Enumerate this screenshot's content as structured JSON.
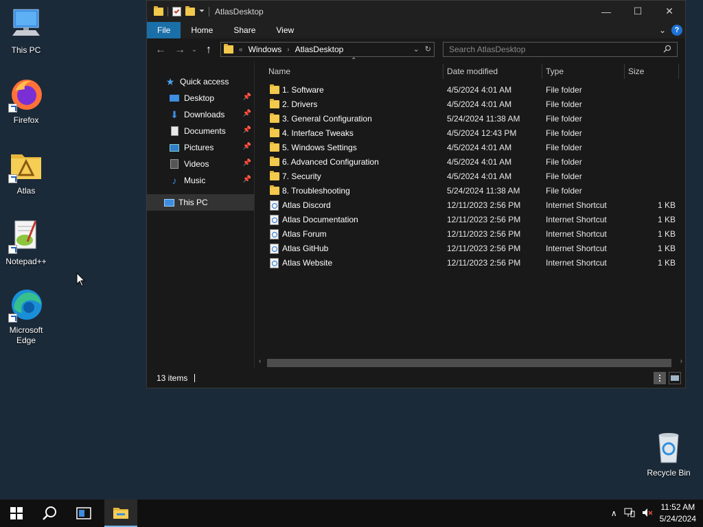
{
  "desktop": {
    "icons": [
      {
        "label": "This PC",
        "icon": "this-pc-icon"
      },
      {
        "label": "Firefox",
        "icon": "firefox-icon"
      },
      {
        "label": "Atlas",
        "icon": "atlas-folder-icon"
      },
      {
        "label": "Notepad++",
        "icon": "notepad-plus-plus-icon"
      },
      {
        "label": "Microsoft Edge",
        "icon": "edge-icon"
      },
      {
        "label": "Recycle Bin",
        "icon": "recycle-bin-icon"
      }
    ]
  },
  "window": {
    "title": "AtlasDesktop",
    "controls": {
      "minimize": "—",
      "maximize": "☐",
      "close": "✕"
    },
    "ribbon": {
      "tabs": [
        "File",
        "Home",
        "Share",
        "View"
      ],
      "help": "?"
    },
    "nav": {
      "back": "←",
      "forward": "→",
      "recent": "⌄",
      "up": "↑"
    },
    "address": {
      "overflow": "«",
      "segments": [
        "Windows",
        "AtlasDesktop"
      ],
      "separator": "›"
    },
    "search": {
      "placeholder": "Search AtlasDesktop"
    },
    "navpane": {
      "quick_access": "Quick access",
      "items": [
        {
          "label": "Desktop",
          "icon": "desktop-icon"
        },
        {
          "label": "Downloads",
          "icon": "downloads-icon"
        },
        {
          "label": "Documents",
          "icon": "documents-icon"
        },
        {
          "label": "Pictures",
          "icon": "pictures-icon"
        },
        {
          "label": "Videos",
          "icon": "videos-icon"
        },
        {
          "label": "Music",
          "icon": "music-icon"
        }
      ],
      "this_pc": "This PC"
    },
    "columns": {
      "name": "Name",
      "date": "Date modified",
      "type": "Type",
      "size": "Size"
    },
    "files": [
      {
        "name": "1. Software",
        "date": "4/5/2024 4:01 AM",
        "type": "File folder",
        "size": "",
        "kind": "folder"
      },
      {
        "name": "2. Drivers",
        "date": "4/5/2024 4:01 AM",
        "type": "File folder",
        "size": "",
        "kind": "folder"
      },
      {
        "name": "3. General Configuration",
        "date": "5/24/2024 11:38 AM",
        "type": "File folder",
        "size": "",
        "kind": "folder"
      },
      {
        "name": "4. Interface Tweaks",
        "date": "4/5/2024 12:43 PM",
        "type": "File folder",
        "size": "",
        "kind": "folder"
      },
      {
        "name": "5. Windows Settings",
        "date": "4/5/2024 4:01 AM",
        "type": "File folder",
        "size": "",
        "kind": "folder"
      },
      {
        "name": "6. Advanced Configuration",
        "date": "4/5/2024 4:01 AM",
        "type": "File folder",
        "size": "",
        "kind": "folder"
      },
      {
        "name": "7. Security",
        "date": "4/5/2024 4:01 AM",
        "type": "File folder",
        "size": "",
        "kind": "folder"
      },
      {
        "name": "8. Troubleshooting",
        "date": "5/24/2024 11:38 AM",
        "type": "File folder",
        "size": "",
        "kind": "folder"
      },
      {
        "name": "Atlas Discord",
        "date": "12/11/2023 2:56 PM",
        "type": "Internet Shortcut",
        "size": "1 KB",
        "kind": "shortcut"
      },
      {
        "name": "Atlas Documentation",
        "date": "12/11/2023 2:56 PM",
        "type": "Internet Shortcut",
        "size": "1 KB",
        "kind": "shortcut"
      },
      {
        "name": "Atlas Forum",
        "date": "12/11/2023 2:56 PM",
        "type": "Internet Shortcut",
        "size": "1 KB",
        "kind": "shortcut"
      },
      {
        "name": "Atlas GitHub",
        "date": "12/11/2023 2:56 PM",
        "type": "Internet Shortcut",
        "size": "1 KB",
        "kind": "shortcut"
      },
      {
        "name": "Atlas Website",
        "date": "12/11/2023 2:56 PM",
        "type": "Internet Shortcut",
        "size": "1 KB",
        "kind": "shortcut"
      }
    ],
    "status": {
      "item_count": "13 items"
    }
  },
  "taskbar": {
    "clock_time": "11:52 AM",
    "clock_date": "5/24/2024",
    "buttons": [
      "start-icon",
      "search-icon",
      "task-view-icon",
      "file-explorer-icon"
    ]
  },
  "colors": {
    "desktop_bg": "#1b2a39",
    "window_bg": "#191919",
    "accent": "#1a6fa8",
    "folder": "#f2c94c"
  }
}
